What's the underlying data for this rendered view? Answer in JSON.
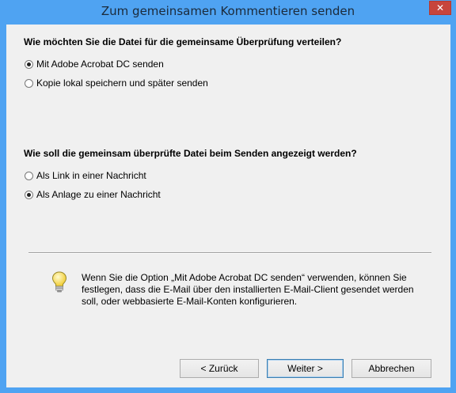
{
  "window": {
    "title": "Zum gemeinsamen Kommentieren senden"
  },
  "section1": {
    "question": "Wie möchten Sie die Datei für die gemeinsame Überprüfung verteilen?",
    "options": [
      {
        "label": "Mit Adobe Acrobat DC senden",
        "checked": true
      },
      {
        "label": "Kopie lokal speichern und später senden",
        "checked": false
      }
    ]
  },
  "section2": {
    "question": "Wie soll die gemeinsam überprüfte Datei beim Senden angezeigt werden?",
    "options": [
      {
        "label": "Als Link in einer Nachricht",
        "checked": false
      },
      {
        "label": "Als Anlage zu einer Nachricht",
        "checked": true
      }
    ]
  },
  "info": {
    "icon": "lightbulb-icon",
    "text": "Wenn Sie die Option „Mit Adobe Acrobat DC senden“ verwenden, können Sie festlegen, dass die E-Mail über den installierten E-Mail-Client gesendet werden soll, oder webbasierte E-Mail-Konten konfigurieren."
  },
  "buttons": {
    "back": "< Zurück",
    "next": "Weiter >",
    "cancel": "Abbrechen"
  },
  "colors": {
    "frame": "#4fa3f2",
    "close": "#c7453c",
    "client": "#f0f0f0"
  }
}
